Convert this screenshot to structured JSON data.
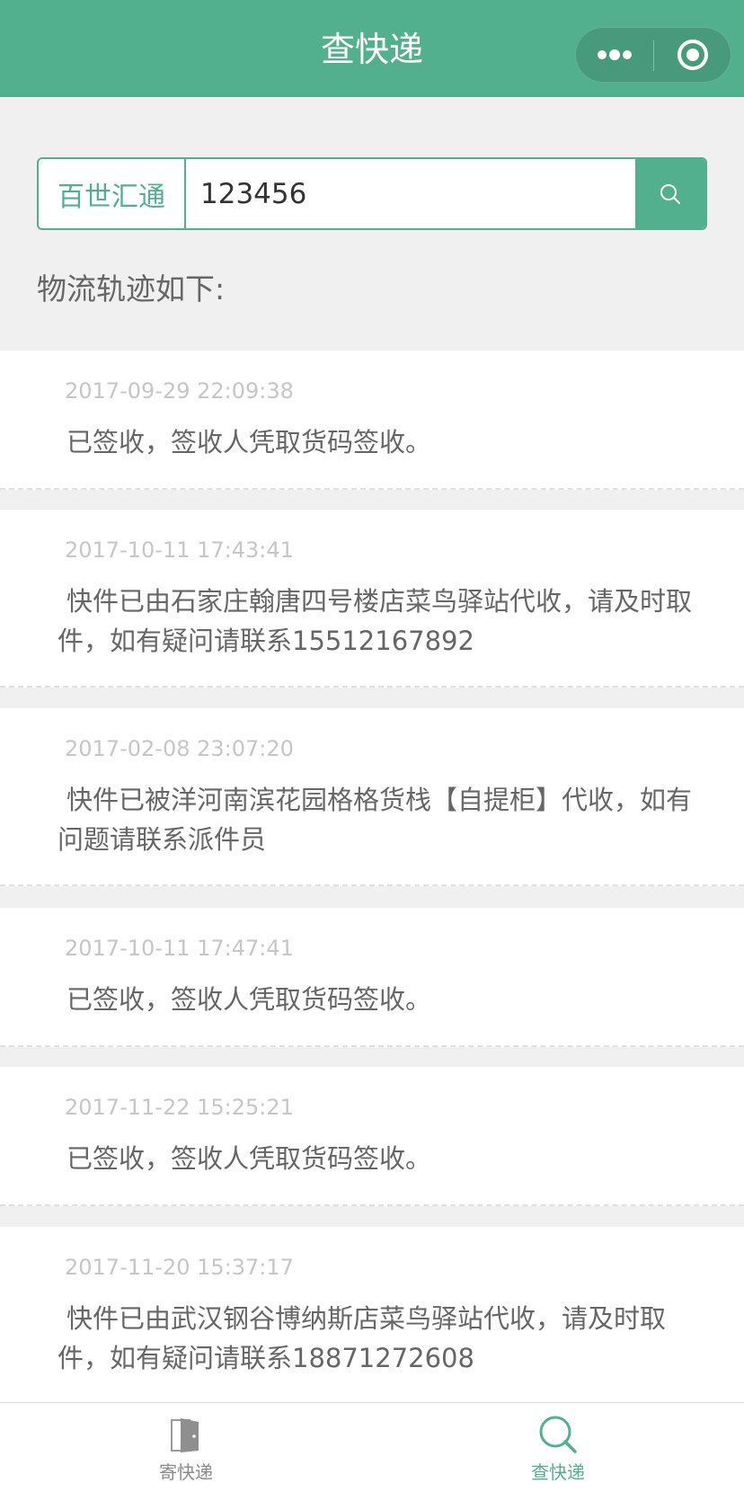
{
  "header": {
    "title": "查快递",
    "more_icon": "more-dots-icon",
    "close_icon": "target-close-icon"
  },
  "search": {
    "carrier": "百世汇通",
    "tracking_number": "123456",
    "button_icon": "search-icon"
  },
  "section_label": "物流轨迹如下:",
  "tracks": [
    {
      "time": "2017-09-29 22:09:38",
      "desc": "已签收，签收人凭取货码签收。"
    },
    {
      "time": "2017-10-11 17:43:41",
      "desc": "快件已由石家庄翰唐四号楼店菜鸟驿站代收，请及时取件，如有疑问请联系15512167892"
    },
    {
      "time": "2017-02-08 23:07:20",
      "desc": "快件已被洋河南滨花园格格货栈【自提柜】代收，如有问题请联系派件员"
    },
    {
      "time": "2017-10-11 17:47:41",
      "desc": "已签收，签收人凭取货码签收。"
    },
    {
      "time": "2017-11-22 15:25:21",
      "desc": "已签收，签收人凭取货码签收。"
    },
    {
      "time": "2017-11-20 15:37:17",
      "desc": "快件已由武汉钢谷博纳斯店菜鸟驿站代收，请及时取件，如有疑问请联系18871272608"
    }
  ],
  "tabbar": {
    "tabs": [
      {
        "label": "寄快递",
        "icon": "door-icon",
        "active": false
      },
      {
        "label": "查快递",
        "icon": "magnifier-icon",
        "active": true
      }
    ]
  },
  "colors": {
    "brand": "#52b08e",
    "background": "#f0f0f0",
    "time_text": "#c6c6c6",
    "body_text": "#666666"
  }
}
